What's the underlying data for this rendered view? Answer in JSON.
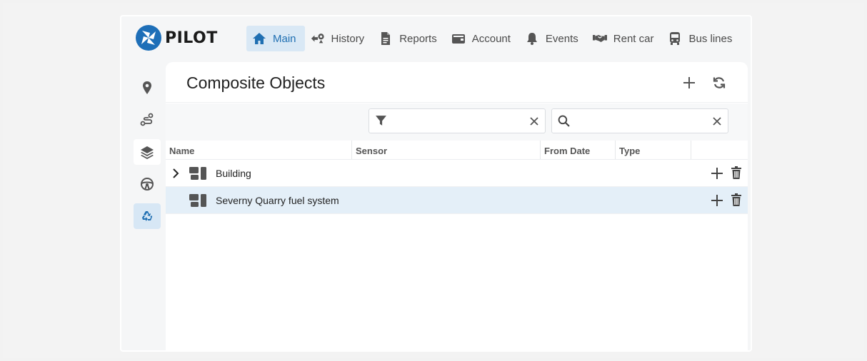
{
  "app": {
    "brand": "PILOT",
    "nav": [
      {
        "label": "Main",
        "icon": "home-icon",
        "active": true
      },
      {
        "label": "History",
        "icon": "history-icon"
      },
      {
        "label": "Reports",
        "icon": "report-icon"
      },
      {
        "label": "Account",
        "icon": "wallet-icon"
      },
      {
        "label": "Events",
        "icon": "bell-icon"
      },
      {
        "label": "Rent car",
        "icon": "handshake-icon"
      },
      {
        "label": "Bus lines",
        "icon": "bus-icon"
      }
    ],
    "sidebar": [
      {
        "icon": "map-marker-icon"
      },
      {
        "icon": "route-icon"
      },
      {
        "icon": "layers-icon"
      },
      {
        "icon": "steering-wheel-icon"
      },
      {
        "icon": "recycle-icon",
        "active": true
      }
    ],
    "accent": "#1f6fb2"
  },
  "panel": {
    "title": "Composite Objects",
    "filter_value": "",
    "search_value": "",
    "columns": [
      "Name",
      "Sensor",
      "From Date",
      "Type"
    ],
    "rows": [
      {
        "name": "Building",
        "expandable": true
      },
      {
        "name": "Severny Quarry fuel system",
        "expandable": false,
        "selected": true
      }
    ]
  }
}
